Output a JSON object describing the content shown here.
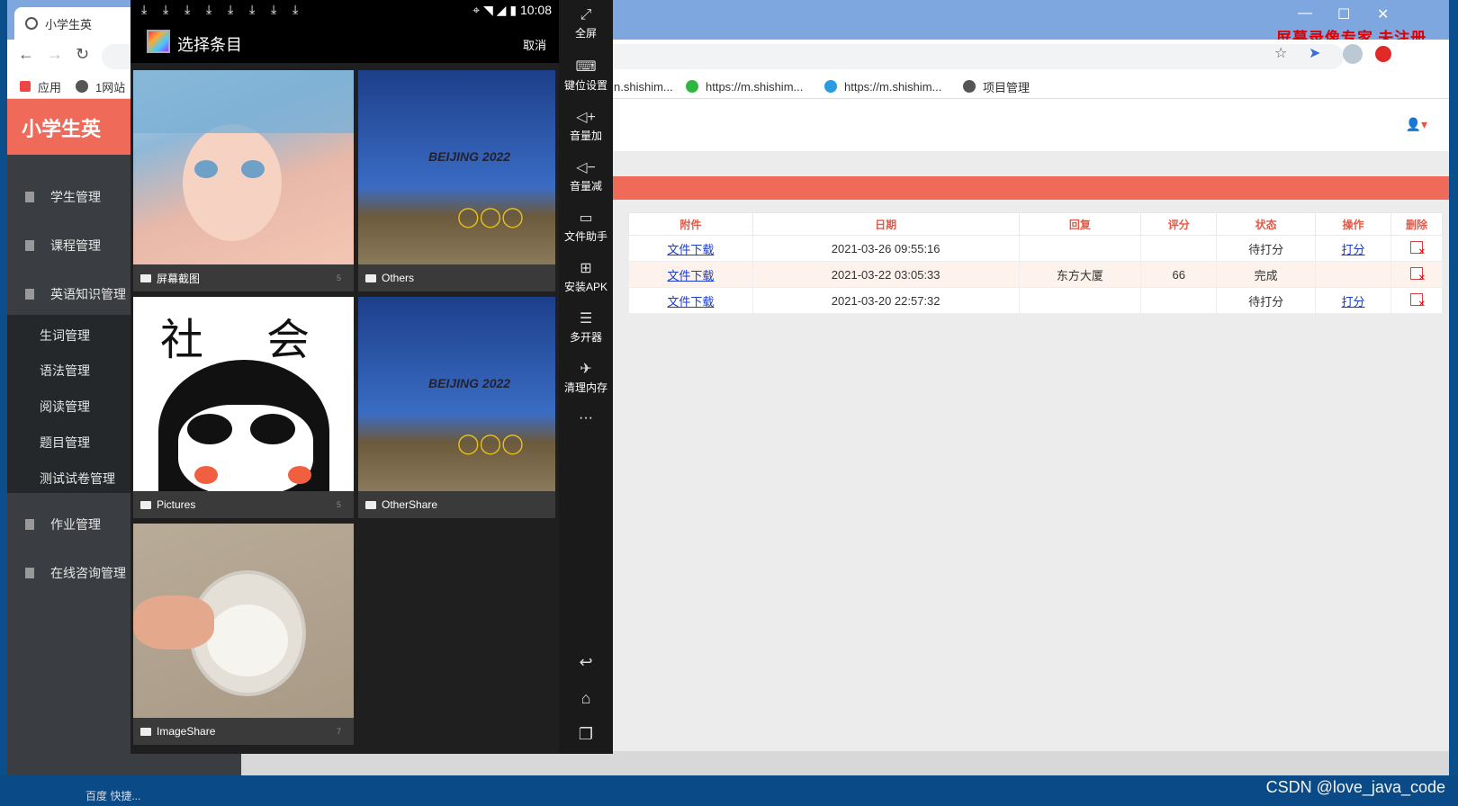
{
  "browser": {
    "tab_title": "小学生英",
    "bookmarks": [
      "应用",
      "1网站",
      "n.shishim...",
      "https://m.shishim...",
      "https://m.shishim...",
      "项目管理"
    ],
    "watermark": "屏幕录像专家  未注册"
  },
  "sidebar": {
    "logo": "小学生英",
    "items": [
      "学生管理",
      "课程管理",
      "英语知识管理",
      "作业管理",
      "在线咨询管理"
    ],
    "subitems": [
      "生词管理",
      "语法管理",
      "阅读管理",
      "题目管理",
      "测试试卷管理"
    ]
  },
  "table": {
    "headers": [
      "附件",
      "日期",
      "回复",
      "评分",
      "状态",
      "操作",
      "删除"
    ],
    "rows": [
      {
        "attachment": "文件下载",
        "date": "2021-03-26 09:55:16",
        "reply": "",
        "score": "",
        "status": "待打分",
        "action": "打分"
      },
      {
        "attachment": "文件下载",
        "date": "2021-03-22 03:05:33",
        "reply": "东方大厦",
        "score": "66",
        "status": "完成",
        "action": ""
      },
      {
        "attachment": "文件下载",
        "date": "2021-03-20 22:57:32",
        "reply": "",
        "score": "",
        "status": "待打分",
        "action": "打分"
      }
    ]
  },
  "emulator": {
    "time": "10:08",
    "picker_title": "选择条目",
    "cancel": "取消",
    "albums": [
      {
        "name": "屏幕截图",
        "count": "5"
      },
      {
        "name": "Others",
        "count": ""
      },
      {
        "name": "Pictures",
        "count": "5"
      },
      {
        "name": "OtherShare",
        "count": ""
      },
      {
        "name": "ImageShare",
        "count": "7"
      }
    ],
    "side_buttons": [
      "全屏",
      "键位设置",
      "音量加",
      "音量减",
      "文件助手",
      "安装APK",
      "多开器",
      "清理内存"
    ],
    "more": "···",
    "thumb_text": {
      "shehui_1": "社",
      "shehui_2": "会",
      "beijing": "BEIJING 2022"
    }
  },
  "desktop": {
    "taskbar_text": "百度    快捷..."
  },
  "footer": {
    "csdn": "CSDN @love_java_code"
  }
}
